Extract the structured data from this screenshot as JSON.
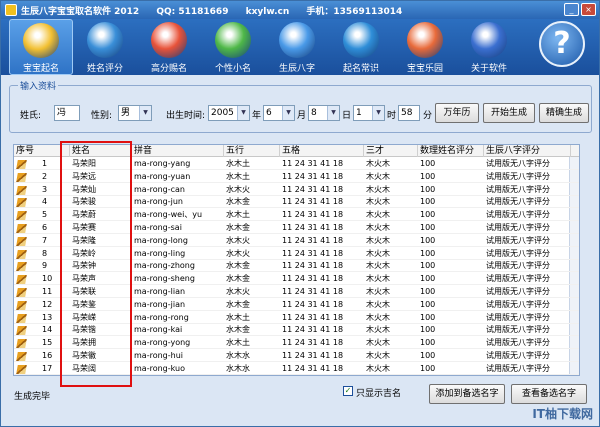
{
  "title": {
    "app": "生辰八字宝宝取名软件 2012",
    "qq": "QQ: 51181669",
    "site": "kxylw.cn",
    "phone": "手机：13569113014"
  },
  "toolbar": [
    {
      "label": "宝宝起名",
      "icon": "baby-icon",
      "color": "#f2c032"
    },
    {
      "label": "姓名评分",
      "icon": "globe-icon",
      "color": "#3a8fd8"
    },
    {
      "label": "高分赐名",
      "icon": "hexagon-icon",
      "color": "#e8533a"
    },
    {
      "label": "个性小名",
      "icon": "windows-icon",
      "color": "#4fb848"
    },
    {
      "label": "生辰八字",
      "icon": "bird-icon",
      "color": "#4a9ae8"
    },
    {
      "label": "起名常识",
      "icon": "ie-icon",
      "color": "#2f8ed8"
    },
    {
      "label": "宝宝乐园",
      "icon": "character-icon",
      "color": "#e86a3a"
    },
    {
      "label": "关于软件",
      "icon": "flag-icon",
      "color": "#3b6fd0"
    }
  ],
  "input": {
    "title": "输入资料",
    "surname_label": "姓氏:",
    "surname": "冯",
    "gender_label": "性别:",
    "gender": "男",
    "birth_label": "出生时间:",
    "year": "2005",
    "year_unit": "年",
    "month": "6",
    "month_unit": "月",
    "day": "8",
    "day_unit": "日",
    "hour": "1",
    "hour_unit": "时",
    "minute": "58",
    "minute_unit": "分",
    "btn_calendar": "万年历",
    "btn_generate": "开始生成",
    "btn_fine": "精确生成"
  },
  "table": {
    "headers": [
      "序号",
      "姓名",
      "拼音",
      "五行",
      "五格",
      "三才",
      "数理姓名评分",
      "生辰八字评分"
    ],
    "rows": [
      [
        "1",
        "马荣阳",
        "ma-rong-yang",
        "水木土",
        "11 24 31 41 18",
        "木火木",
        "100",
        "试用版无八字评分"
      ],
      [
        "2",
        "马荣远",
        "ma-rong-yuan",
        "水木土",
        "11 24 31 41 18",
        "木火木",
        "100",
        "试用版无八字评分"
      ],
      [
        "3",
        "马荣灿",
        "ma-rong-can",
        "水木火",
        "11 24 31 41 18",
        "木火木",
        "100",
        "试用版无八字评分"
      ],
      [
        "4",
        "马荣骏",
        "ma-rong-jun",
        "水木金",
        "11 24 31 41 18",
        "木火木",
        "100",
        "试用版无八字评分"
      ],
      [
        "5",
        "马荣蔚",
        "ma-rong-wei、yu",
        "水木土",
        "11 24 31 41 18",
        "木火木",
        "100",
        "试用版无八字评分"
      ],
      [
        "6",
        "马荣赛",
        "ma-rong-sai",
        "水木金",
        "11 24 31 41 18",
        "木火木",
        "100",
        "试用版无八字评分"
      ],
      [
        "7",
        "马荣隆",
        "ma-rong-long",
        "水木火",
        "11 24 31 41 18",
        "木火木",
        "100",
        "试用版无八字评分"
      ],
      [
        "8",
        "马荣岭",
        "ma-rong-ling",
        "水木火",
        "11 24 31 41 18",
        "木火木",
        "100",
        "试用版无八字评分"
      ],
      [
        "9",
        "马荣钟",
        "ma-rong-zhong",
        "水木金",
        "11 24 31 41 18",
        "木火木",
        "100",
        "试用版无八字评分"
      ],
      [
        "10",
        "马荣声",
        "ma-rong-sheng",
        "水木金",
        "11 24 31 41 18",
        "木火木",
        "100",
        "试用版无八字评分"
      ],
      [
        "11",
        "马荣联",
        "ma-rong-lian",
        "水木火",
        "11 24 31 41 18",
        "木火木",
        "100",
        "试用版无八字评分"
      ],
      [
        "12",
        "马荣鉴",
        "ma-rong-jian",
        "水木金",
        "11 24 31 41 18",
        "木火木",
        "100",
        "试用版无八字评分"
      ],
      [
        "13",
        "马荣嵘",
        "ma-rong-rong",
        "水木土",
        "11 24 31 41 18",
        "木火木",
        "100",
        "试用版无八字评分"
      ],
      [
        "14",
        "马荣锴",
        "ma-rong-kai",
        "水木金",
        "11 24 31 41 18",
        "木火木",
        "100",
        "试用版无八字评分"
      ],
      [
        "15",
        "马荣拥",
        "ma-rong-yong",
        "水木土",
        "11 24 31 41 18",
        "木火木",
        "100",
        "试用版无八字评分"
      ],
      [
        "16",
        "马荣徽",
        "ma-rong-hui",
        "水木水",
        "11 24 31 41 18",
        "木火木",
        "100",
        "试用版无八字评分"
      ],
      [
        "17",
        "马荣阔",
        "ma-rong-kuo",
        "水木水",
        "11 24 31 41 18",
        "木火木",
        "100",
        "试用版无八字评分"
      ]
    ]
  },
  "status": {
    "text": "生成完毕",
    "checkbox_label": "只显示吉名",
    "btn_add": "添加到备选名字",
    "btn_view": "查看备选名字"
  },
  "watermark": "IT柚下载网"
}
